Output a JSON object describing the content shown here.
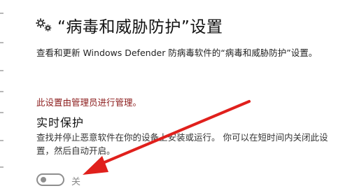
{
  "header": {
    "icon": "gear-icon",
    "title": "“病毒和威胁防护”设置"
  },
  "description": "查看和更新 Windows Defender 防病毒软件的“病毒和威胁防护”设置。",
  "admin_note": "此设置由管理员进行管理。",
  "realtime": {
    "title": "实时保护",
    "description": "查找并停止恶意软件在你的设备上安装或运行。 你可以在短时间内关闭此设置，然后自动开启。",
    "toggle_state": "关",
    "toggle_on": false
  },
  "colors": {
    "admin_note": "#8b1a1a",
    "arrow": "#e0201c"
  }
}
